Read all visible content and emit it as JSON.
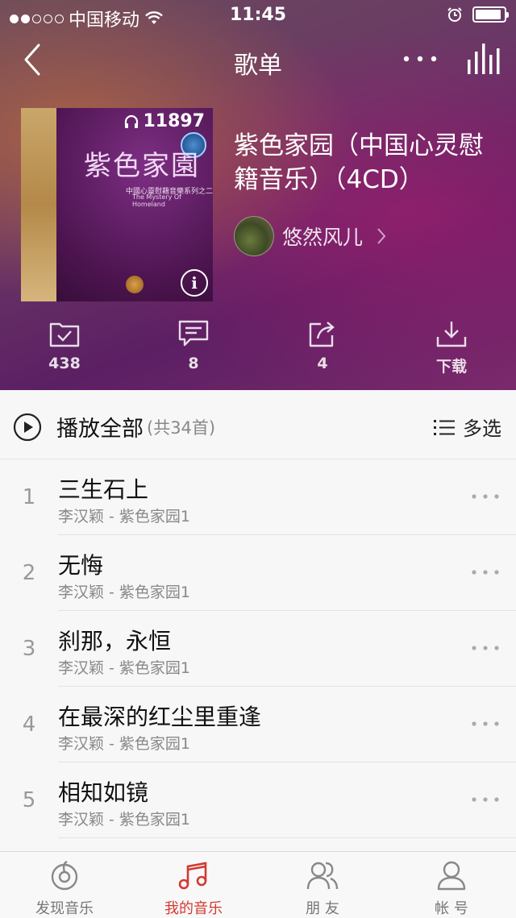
{
  "status_bar": {
    "carrier": "中国移动",
    "time": "11:45",
    "signal_bars": 2,
    "battery_level": 0.9
  },
  "nav": {
    "title": "歌单"
  },
  "playlist": {
    "play_count": "11897",
    "cover_title": "紫色家園",
    "cover_subtitle": "中國心靈慰藉音樂系列之二",
    "cover_english": "The Mystery Of Homeland",
    "name": "紫色家园（中国心灵慰籍音乐）（4CD）",
    "creator": "悠然风儿"
  },
  "actions": [
    {
      "icon": "favorite-check-icon",
      "label": "438"
    },
    {
      "icon": "comment-icon",
      "label": "8"
    },
    {
      "icon": "share-icon",
      "label": "4"
    },
    {
      "icon": "download-icon",
      "label": "下载"
    }
  ],
  "list": {
    "play_all_label": "播放全部",
    "count_label": "(共34首)",
    "multi_select_label": "多选",
    "songs": [
      {
        "index": "1",
        "title": "三生石上",
        "subtitle": "李汉颖 - 紫色家园1"
      },
      {
        "index": "2",
        "title": "无悔",
        "subtitle": "李汉颖 - 紫色家园1"
      },
      {
        "index": "3",
        "title": "刹那，永恒",
        "subtitle": "李汉颖 - 紫色家园1"
      },
      {
        "index": "4",
        "title": "在最深的红尘里重逢",
        "subtitle": "李汉颖 - 紫色家园1"
      },
      {
        "index": "5",
        "title": "相知如镜",
        "subtitle": "李汉颖 - 紫色家园1"
      }
    ]
  },
  "tabs": [
    {
      "icon": "discover-music-icon",
      "label": "发现音乐",
      "active": false
    },
    {
      "icon": "my-music-icon",
      "label": "我的音乐",
      "active": true
    },
    {
      "icon": "friends-icon",
      "label": "朋 友",
      "active": false
    },
    {
      "icon": "account-icon",
      "label": "帐 号",
      "active": false
    }
  ],
  "colors": {
    "accent": "#d33a31",
    "hero_bg": "#5b1f63",
    "list_bg": "#f7f7f8"
  }
}
